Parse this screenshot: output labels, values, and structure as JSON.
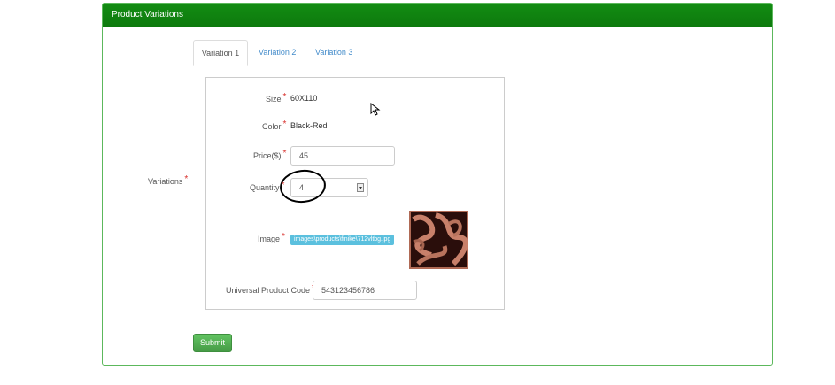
{
  "panel": {
    "title": "Product Variations"
  },
  "tabs": [
    {
      "label": "Variation 1",
      "active": true
    },
    {
      "label": "Variation 2",
      "active": false
    },
    {
      "label": "Variation 3",
      "active": false
    }
  ],
  "variations_label": "Variations",
  "required_mark": "*",
  "fields": {
    "size": {
      "label": "Size",
      "value": "60X110"
    },
    "color": {
      "label": "Color",
      "value": "Black-Red"
    },
    "price": {
      "label": "Price($)",
      "value": "45"
    },
    "quantity": {
      "label": "Quantity",
      "value": "4"
    },
    "image": {
      "label": "Image",
      "file": "images\\products\\finike\\712vltbg.jpg"
    },
    "upc": {
      "label": "Universal Product Code",
      "value": "543123456786"
    }
  },
  "submit_label": "Submit",
  "colors": {
    "header_green": "#138c13",
    "border_green": "#5cb85c",
    "link_blue": "#428bca",
    "badge_blue": "#5bc0de",
    "required_red": "#d9302c"
  }
}
